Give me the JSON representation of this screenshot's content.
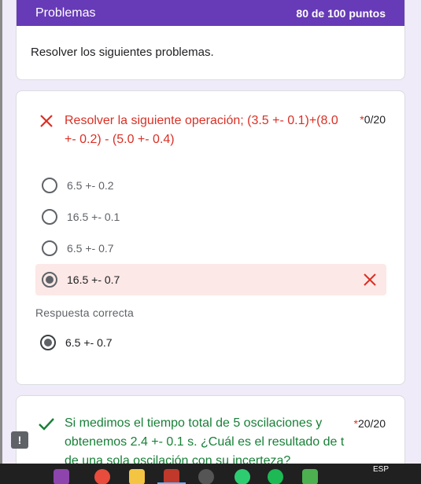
{
  "section": {
    "title": "Problemas",
    "score": "80 de 100 puntos",
    "description": "Resolver los siguientes problemas."
  },
  "question1": {
    "status_icon": "incorrect-x-icon",
    "text": "Resolver la siguiente operación; (3.5 +- 0.1)+(8.0 +- 0.2) - (5.0 +- 0.4)",
    "required_mark": "*",
    "score": "0/20",
    "options": [
      {
        "label": "6.5 +- 0.2",
        "selected": false
      },
      {
        "label": "16.5 +- 0.1",
        "selected": false
      },
      {
        "label": "6.5 +- 0.7",
        "selected": false
      },
      {
        "label": "16.5 +- 0.7",
        "selected": true,
        "incorrect": true
      }
    ],
    "correct_heading": "Respuesta correcta",
    "correct_answer": "6.5 +- 0.7"
  },
  "question2": {
    "status_icon": "correct-check-icon",
    "text": "Si medimos el tiempo total de 5 oscilaciones y obtenemos 2.4 +- 0.1 s. ¿Cuál es el resultado de t de una sola oscilación con su incerteza?",
    "required_mark": "*",
    "score": "20/20"
  },
  "feedback_button": "!",
  "taskbar": {
    "language": "ESP",
    "icons": [
      "browser-icon",
      "chrome-icon",
      "file-explorer-icon",
      "app-icon",
      "media-icon",
      "edge-icon",
      "spotify-icon",
      "app-icon-2"
    ]
  },
  "colors": {
    "accent": "#673ab7",
    "incorrect": "#d93025",
    "correct": "#188038",
    "incorrect_bg": "#fce8e6"
  }
}
